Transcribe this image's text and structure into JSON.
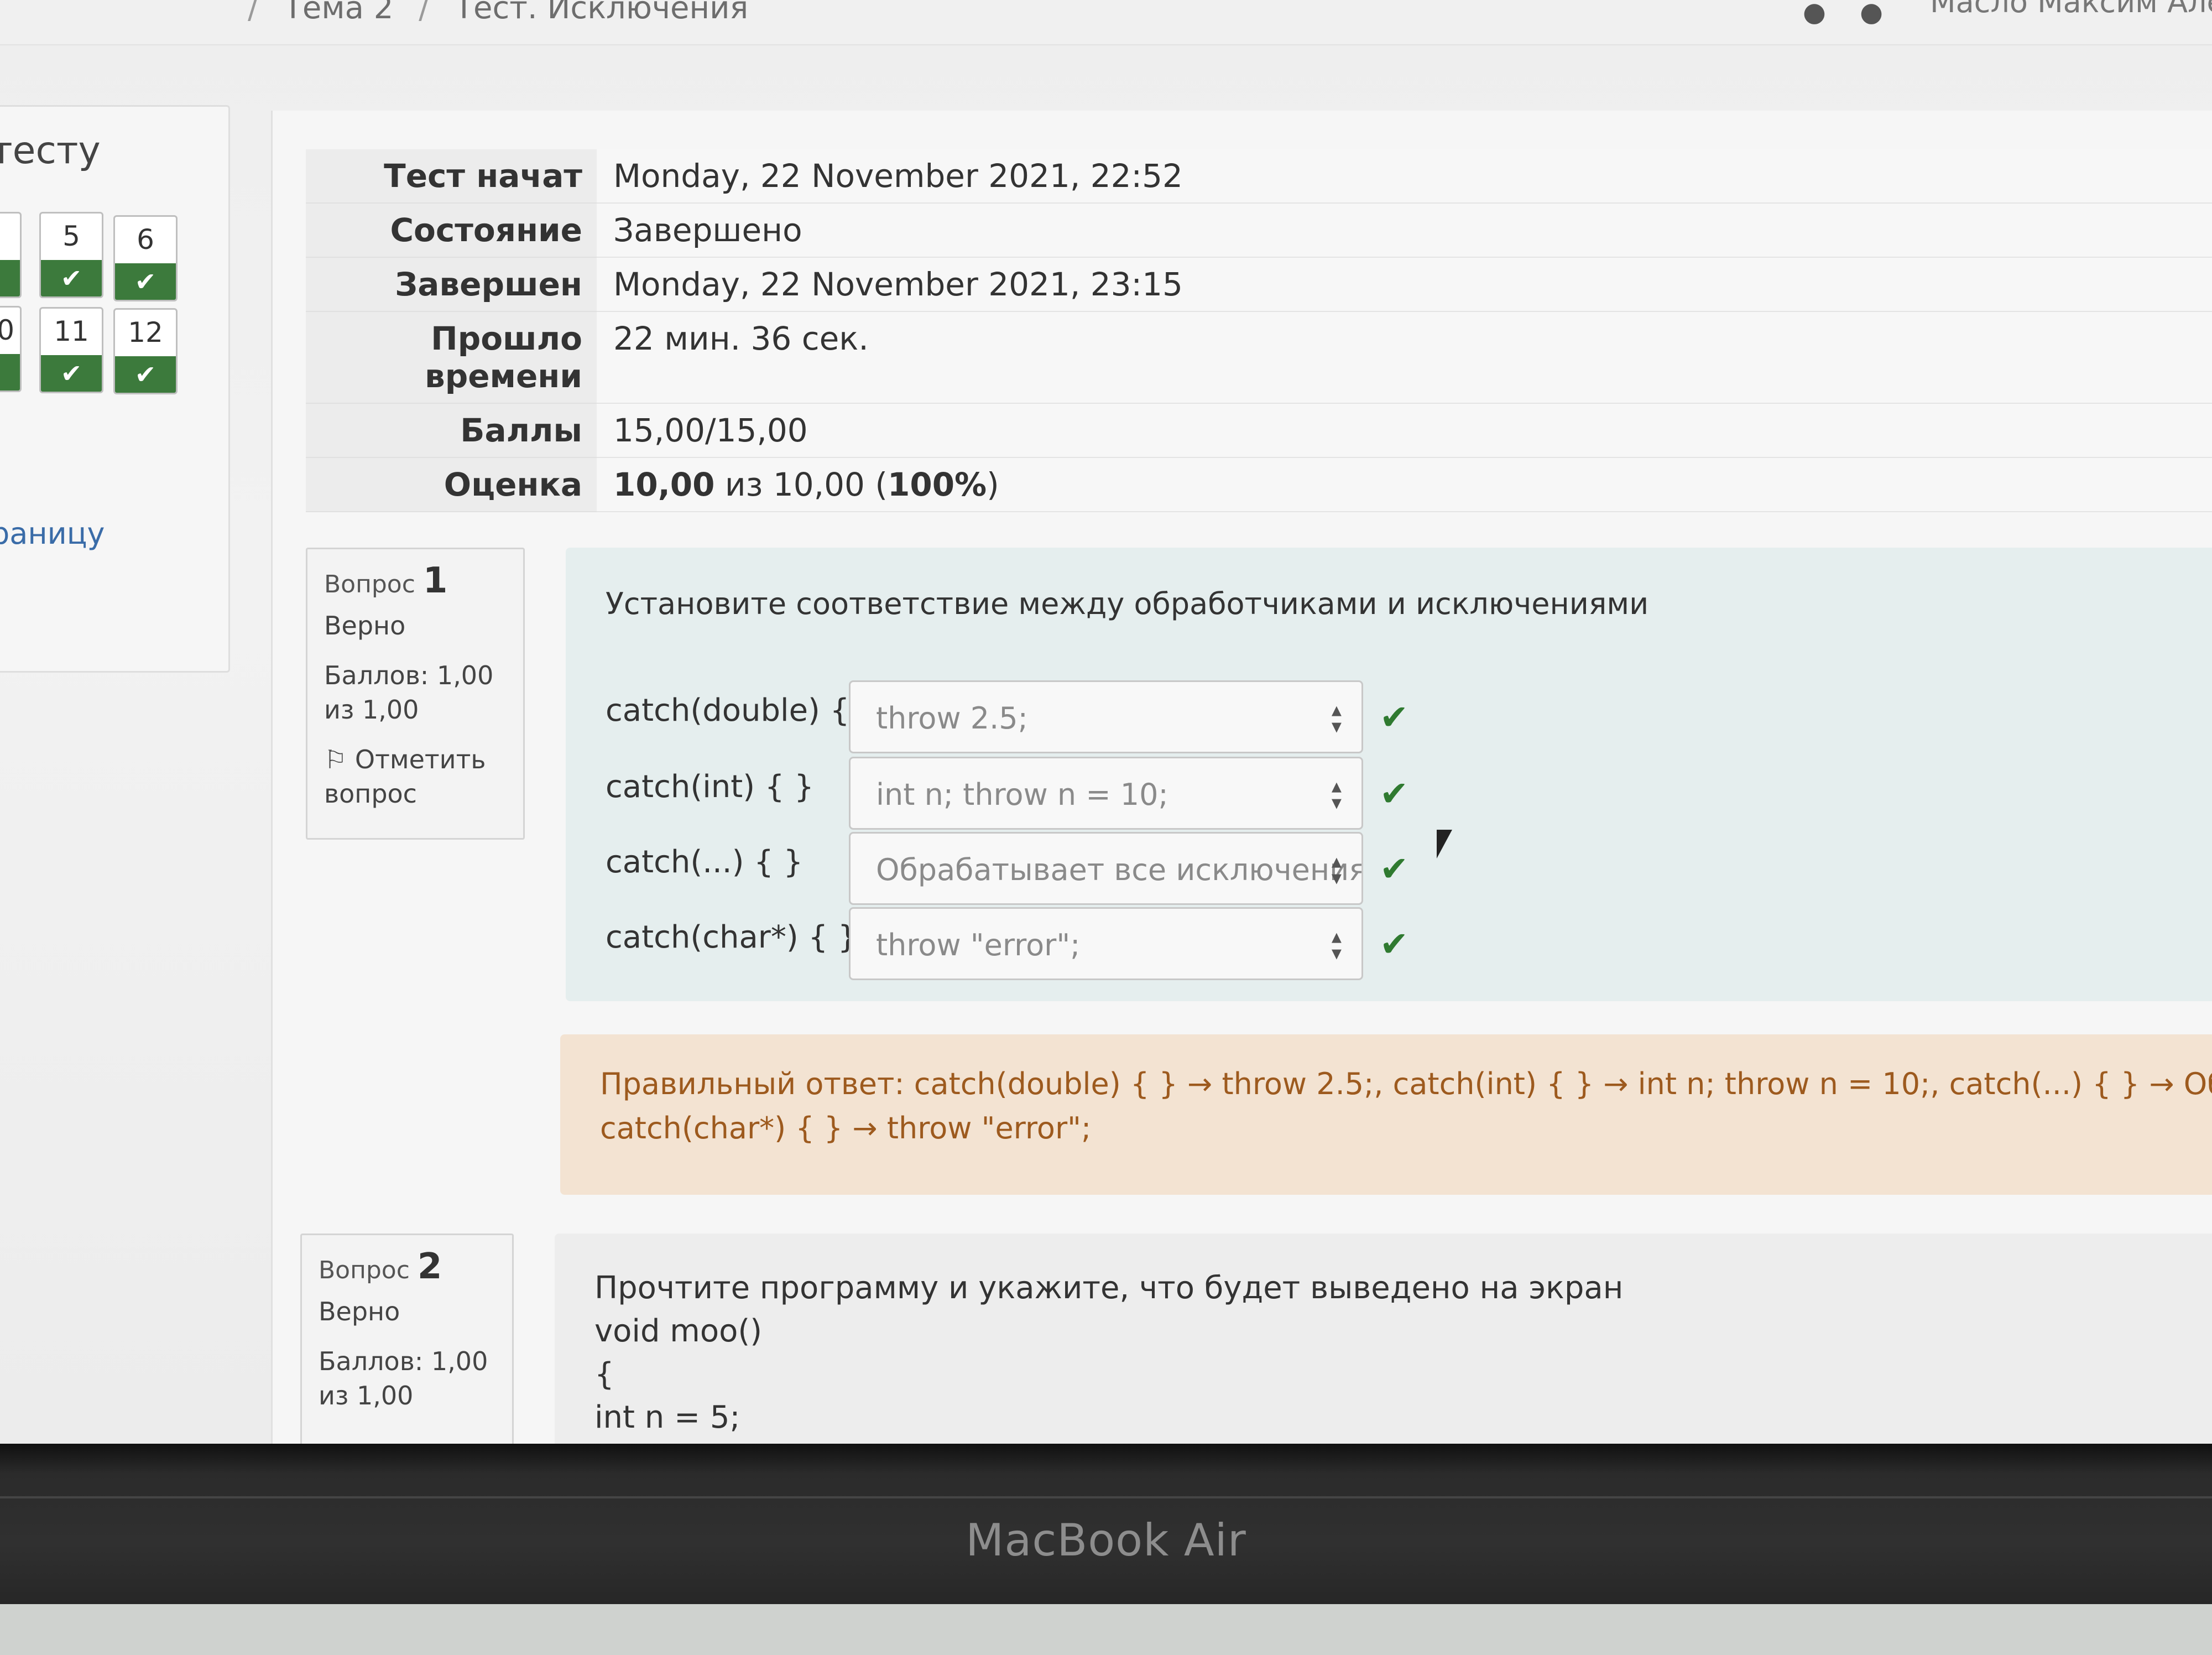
{
  "breadcrumb": {
    "item1": "Тема 2",
    "item2": "Тест. Исключения"
  },
  "header": {
    "user_name": "Масло Максим Алекс"
  },
  "nav": {
    "title": "тесту",
    "buttons": [
      {
        "num": "5",
        "status": "✔"
      },
      {
        "num": "6",
        "status": "✔"
      },
      {
        "num": "11",
        "status": "✔"
      },
      {
        "num": "12",
        "status": "✔"
      }
    ],
    "partial_left_top": "",
    "partial_left_bottom": "0",
    "page_link": "раницу"
  },
  "summary": {
    "started_label": "Тест начат",
    "started_value": "Monday, 22 November 2021, 22:52",
    "state_label": "Состояние",
    "state_value": "Завершено",
    "completed_label": "Завершен",
    "completed_value": "Monday, 22 November 2021, 23:15",
    "time_label_1": "Прошло",
    "time_label_2": "времени",
    "time_value": "22 мин. 36 сек.",
    "marks_label": "Баллы",
    "marks_value": "15,00/15,00",
    "grade_label": "Оценка",
    "grade_bold": "10,00",
    "grade_of": "из 10,00 (",
    "grade_percent": "100%",
    "grade_close": ")"
  },
  "q1": {
    "label": "Вопрос",
    "number": "1",
    "state": "Верно",
    "marks_1": "Баллов: 1,00",
    "marks_2": "из 1,00",
    "flag_1": "Отметить",
    "flag_2": "вопрос",
    "text": "Установите соответствие между обработчиками и исключениями",
    "rows": [
      {
        "stem": "catch(double) { }",
        "answer": "throw 2.5;"
      },
      {
        "stem": "catch(int) { }",
        "answer": "int n; throw n = 10;"
      },
      {
        "stem": "catch(...) { }",
        "answer": "Обрабатывает все исключения"
      },
      {
        "stem": "catch(char*) { }",
        "answer": "throw \"error\";"
      }
    ],
    "right_answer_1": "Правильный ответ: catch(double) { } → throw 2.5;, catch(int) { } → int n; throw n = 10;, catch(...) { } → Обрабатывает все иск",
    "right_answer_2": "catch(char*) { } → throw \"error\";"
  },
  "q2": {
    "label": "Вопрос",
    "number": "2",
    "state": "Верно",
    "marks_1": "Баллов: 1,00",
    "marks_2": "из 1,00",
    "lines": [
      "Прочтите программу и укажите, что будет выведено на экран",
      "void moo()",
      "{",
      "int n = 5;"
    ]
  },
  "laptop": {
    "brand": "MacBook Air"
  },
  "colors": {
    "correct": "#2f7a30",
    "right_answer_bg": "#f3e3d2",
    "formulation_bg": "#e5eeee"
  },
  "icons": [
    "flag-icon",
    "check-icon",
    "select-arrows-icon",
    "bell-icon",
    "chat-icon"
  ]
}
